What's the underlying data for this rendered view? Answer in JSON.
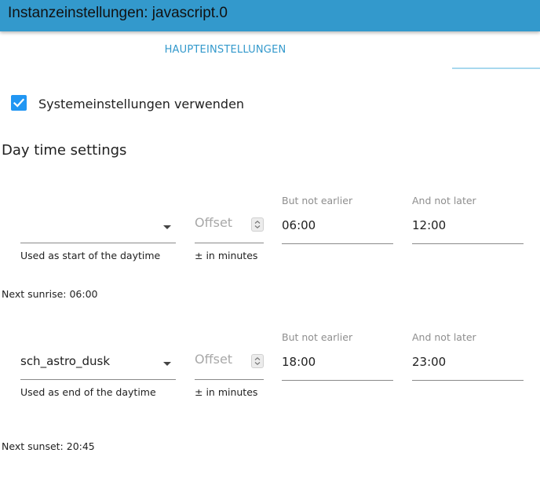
{
  "window": {
    "title": "Instanzeinstellungen: javascript.0"
  },
  "tabs": [
    {
      "label": "HAUPTEINSTELLUNGEN"
    }
  ],
  "system_settings": {
    "label": "Systemeinstellungen verwenden",
    "checked": true
  },
  "section": {
    "title": "Day time settings"
  },
  "start": {
    "event_value": "",
    "event_helper": "Used as start of the daytime",
    "offset_placeholder": "Offset",
    "offset_helper": "± in minutes",
    "earliest_label": "But not earlier",
    "earliest_value": "06:00",
    "latest_label": "And not later",
    "latest_value": "12:00",
    "next_info": "Next sunrise: 06:00"
  },
  "end": {
    "event_value": "sch_astro_dusk",
    "event_helper": "Used as end of the daytime",
    "offset_placeholder": "Offset",
    "offset_helper": "± in minutes",
    "earliest_label": "But not earlier",
    "earliest_value": "18:00",
    "latest_label": "And not later",
    "latest_value": "23:00",
    "next_info": "Next sunset: 20:45"
  },
  "colors": {
    "header": "#3399cc",
    "accent": "#2196f3",
    "tab_text": "#3399cc"
  }
}
